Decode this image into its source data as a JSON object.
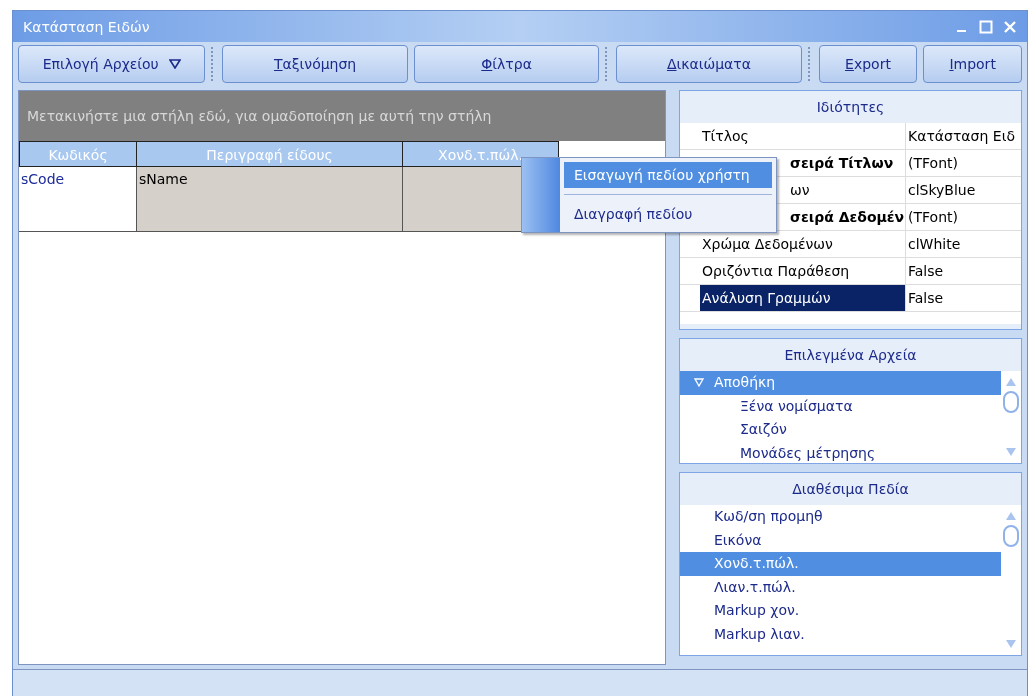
{
  "window": {
    "title": "Κατάσταση Ειδών"
  },
  "toolbar": [
    {
      "kind": "dropdown",
      "label": "Επιλογή Αρχείου"
    },
    {
      "kind": "button",
      "label": "Ταξινόμηση",
      "mnemonic": true
    },
    {
      "kind": "button",
      "label": "Φίλτρα",
      "mnemonic": true
    },
    {
      "kind": "button",
      "label": "Δικαιώματα",
      "mnemonic": true
    },
    {
      "kind": "button",
      "label": "Export",
      "mnemonic": true
    },
    {
      "kind": "button",
      "label": "Import",
      "mnemonic": true
    }
  ],
  "grid": {
    "group_hint": "Μετακινήστε μια στήλη εδώ, για ομαδοποίηση με αυτή την στήλη",
    "columns": [
      "Κωδικός",
      "Περιγραφή είδους",
      "Χονδ.τ.πώλ."
    ],
    "rows": [
      [
        "sCode",
        "sName",
        ""
      ]
    ]
  },
  "context_menu": [
    {
      "label": "Εισαγωγή πεδίου χρήστη",
      "selected": true
    },
    {
      "label": "Διαγραφή πεδίου",
      "selected": false
    }
  ],
  "properties": {
    "title": "Ιδιότητες",
    "rows": [
      {
        "name": "Τίτλος",
        "value": "Κατάσταση Ειδ",
        "bold": false,
        "covered": false,
        "selected": false
      },
      {
        "name": "σειρά Τίτλων",
        "value": "(TFont)",
        "bold": true,
        "covered": true,
        "selected": false
      },
      {
        "name": "ων",
        "value": "clSkyBlue",
        "bold": false,
        "covered": true,
        "selected": false
      },
      {
        "name": "σειρά Δεδομέν",
        "value": "(TFont)",
        "bold": true,
        "covered": true,
        "selected": false
      },
      {
        "name": "Χρώμα Δεδομένων",
        "value": "clWhite",
        "bold": false,
        "covered": false,
        "selected": false
      },
      {
        "name": "Οριζόντια Παράθεση",
        "value": "False",
        "bold": false,
        "covered": false,
        "selected": false
      },
      {
        "name": "Ανάλυση Γραμμών",
        "value": "False",
        "bold": false,
        "covered": false,
        "selected": true
      }
    ]
  },
  "selected_files": {
    "title": "Επιλεγμένα Αρχεία",
    "items": [
      {
        "label": "Αποθήκη",
        "selected": true,
        "expanded": true,
        "children": [
          {
            "label": "Ξένα νομίσματα",
            "selected": false
          },
          {
            "label": "Σαιζόν",
            "selected": false
          },
          {
            "label": "Μονάδες μέτρησης",
            "selected": false
          }
        ]
      }
    ]
  },
  "available_fields": {
    "title": "Διαθέσιμα Πεδία",
    "items": [
      {
        "label": "Κωδ/ση προμηθ",
        "selected": false
      },
      {
        "label": "Εικόνα",
        "selected": false
      },
      {
        "label": "Χονδ.τ.πώλ.",
        "selected": true
      },
      {
        "label": "Λιαν.τ.πώλ.",
        "selected": false
      },
      {
        "label": "Markup χον.",
        "selected": false
      },
      {
        "label": "Markup λιαν.",
        "selected": false
      }
    ]
  }
}
